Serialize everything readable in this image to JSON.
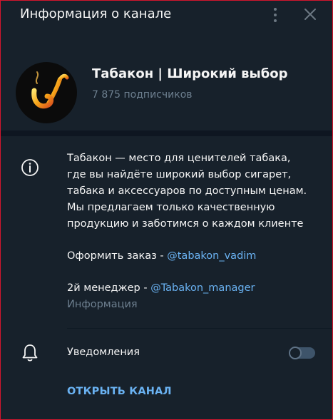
{
  "window": {
    "title": "Информация о канале"
  },
  "icons": {
    "menu": "kebab-menu-icon",
    "close": "close-icon",
    "info": "info-icon",
    "bell": "bell-icon"
  },
  "channel": {
    "name": "Табакон | Широкий выбор",
    "subscribers": "7 875 подписчиков"
  },
  "description": {
    "lines": [
      "Табакон — место для ценителей табака,",
      "где вы найдёте широкий выбор сигарет,",
      "табака и аксессуаров по доступным ценам.",
      "Мы предлагаем только качественную",
      "продукцию и заботимся о каждом клиенте"
    ],
    "order_prefix": "Оформить заказ - ",
    "order_link": "@tabakon_vadim",
    "manager_prefix": "2й менеджер - ",
    "manager_link": "@Tabakon_manager",
    "label": "Информация"
  },
  "notifications": {
    "label": "Уведомления",
    "enabled": false
  },
  "actions": {
    "open_channel": "ОТКРЫТЬ КАНАЛ"
  },
  "colors": {
    "background": "#17212b",
    "accent": "#6ab2f2",
    "secondary_text": "#6d7f8f",
    "frame_border": "#d4162d"
  }
}
